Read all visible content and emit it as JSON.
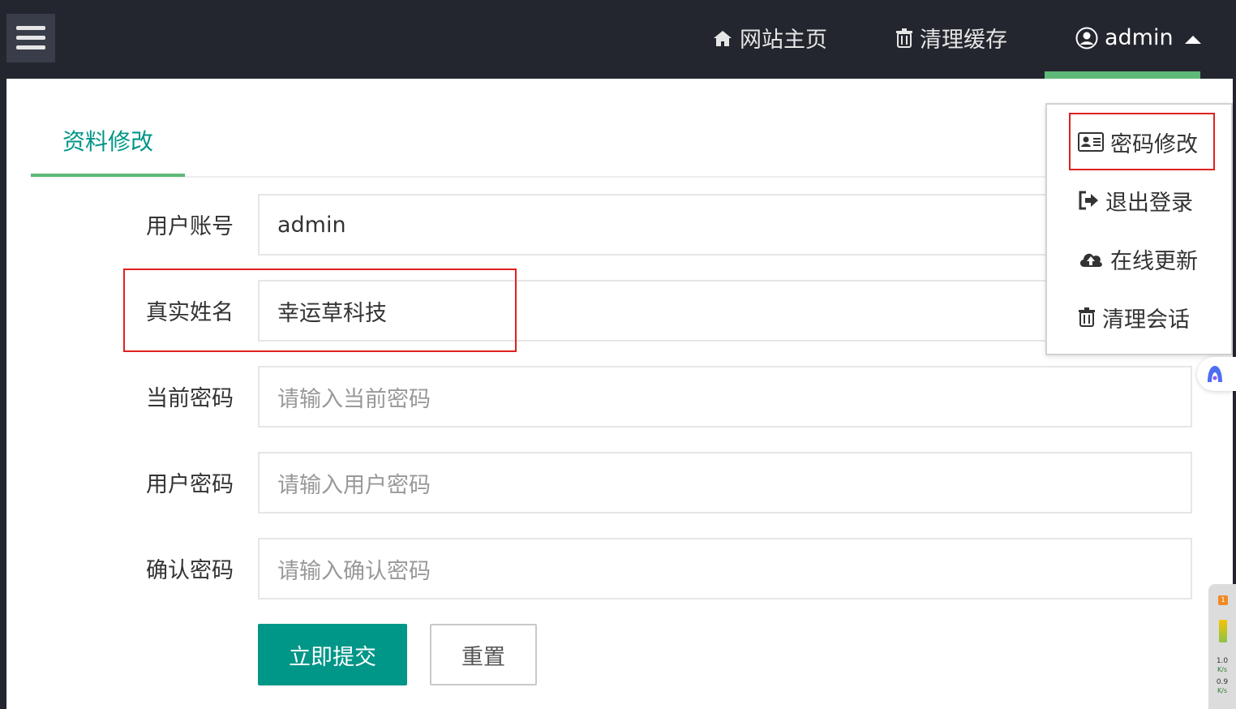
{
  "header": {
    "home_label": "网站主页",
    "cache_label": "清理缓存",
    "user_label": "admin"
  },
  "tab": {
    "title": "资料修改"
  },
  "form": {
    "account": {
      "label": "用户账号",
      "value": "admin"
    },
    "realname": {
      "label": "真实姓名",
      "value": "幸运草科技"
    },
    "current_password": {
      "label": "当前密码",
      "placeholder": "请输入当前密码"
    },
    "user_password": {
      "label": "用户密码",
      "placeholder": "请输入用户密码"
    },
    "confirm_password": {
      "label": "确认密码",
      "placeholder": "请输入确认密码"
    },
    "submit_label": "立即提交",
    "reset_label": "重置"
  },
  "dropdown": {
    "items": [
      {
        "label": "密码修改",
        "icon": "id-card-icon"
      },
      {
        "label": "退出登录",
        "icon": "sign-out-icon"
      },
      {
        "label": "在线更新",
        "icon": "cloud-upload-icon"
      },
      {
        "label": "清理会话",
        "icon": "trash-icon"
      }
    ]
  },
  "speed_widget": {
    "badge": "1",
    "upload_value": "1.0",
    "upload_unit": "K/s",
    "download_value": "0.9",
    "download_unit": "K/s"
  },
  "colors": {
    "header_bg": "#23262e",
    "accent_green": "#5fb878",
    "primary_teal": "#009688",
    "highlight_red": "#e02020"
  }
}
